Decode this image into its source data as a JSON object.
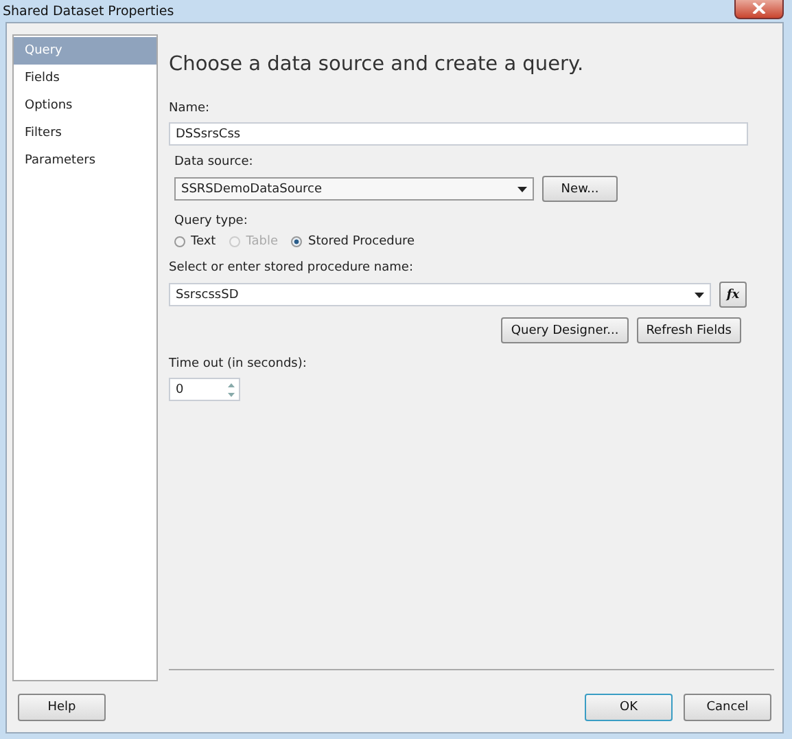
{
  "window": {
    "title": "Shared Dataset Properties"
  },
  "sidebar": {
    "items": [
      {
        "label": "Query",
        "selected": true
      },
      {
        "label": "Fields",
        "selected": false
      },
      {
        "label": "Options",
        "selected": false
      },
      {
        "label": "Filters",
        "selected": false
      },
      {
        "label": "Parameters",
        "selected": false
      }
    ]
  },
  "heading": "Choose a data source and create a query.",
  "name": {
    "label": "Name:",
    "value": "DSSsrsCss"
  },
  "data_source": {
    "label": "Data source:",
    "value": "SSRSDemoDataSource",
    "new_button": "New..."
  },
  "query_type": {
    "label": "Query type:",
    "options": [
      {
        "label": "Text",
        "selected": false,
        "disabled": false
      },
      {
        "label": "Table",
        "selected": false,
        "disabled": true
      },
      {
        "label": "Stored Procedure",
        "selected": true,
        "disabled": false
      }
    ]
  },
  "procedure": {
    "label": "Select or enter stored procedure name:",
    "value": "SsrscssSD",
    "expression_button": "fx"
  },
  "query_buttons": [
    "Query Designer...",
    "Refresh Fields"
  ],
  "timeout": {
    "label": "Time out (in seconds):",
    "value": "0"
  },
  "footer": {
    "help": "Help",
    "ok": "OK",
    "cancel": "Cancel"
  }
}
